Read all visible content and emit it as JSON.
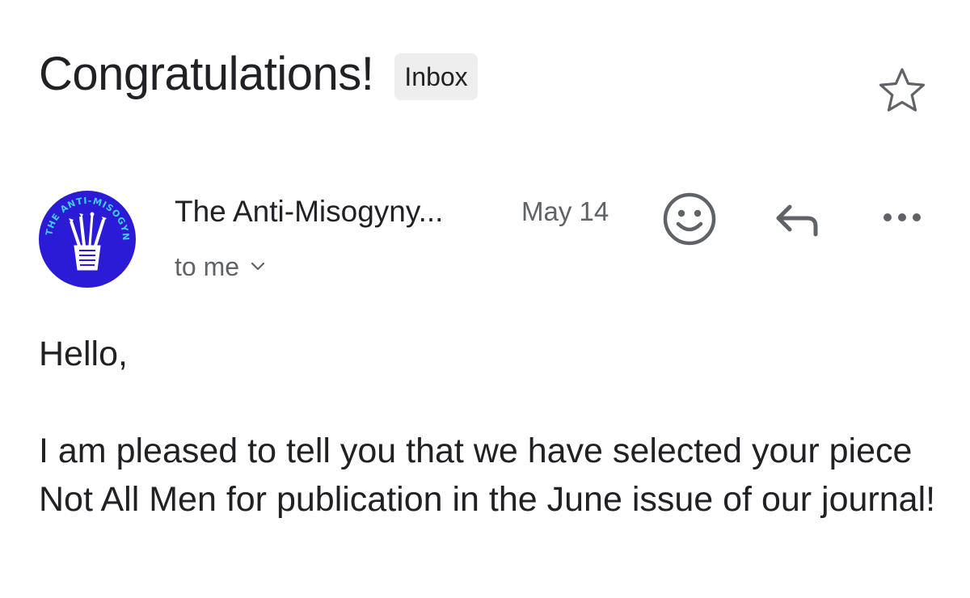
{
  "email": {
    "subject": "Congratulations!",
    "label": "Inbox",
    "sender_name": "The Anti-Misogyny...",
    "date": "May 14",
    "recipient": "to me",
    "avatar_text": "THE ANTI-MISOGYNY CLUB",
    "body": {
      "greeting": "Hello,",
      "paragraph": "I am pleased to tell you that we have selected your piece Not All Men for publication in the June issue of our journal!"
    }
  },
  "icons": {
    "star": "star-icon",
    "emoji": "smiley-icon",
    "reply": "reply-icon",
    "more": "more-horizontal-icon",
    "chevron": "chevron-down-icon"
  },
  "colors": {
    "avatar_bg": "#2b1ad6",
    "avatar_accent": "#3fd0f0",
    "chip_bg": "#eeeeee",
    "secondary_text": "#5f6368"
  }
}
